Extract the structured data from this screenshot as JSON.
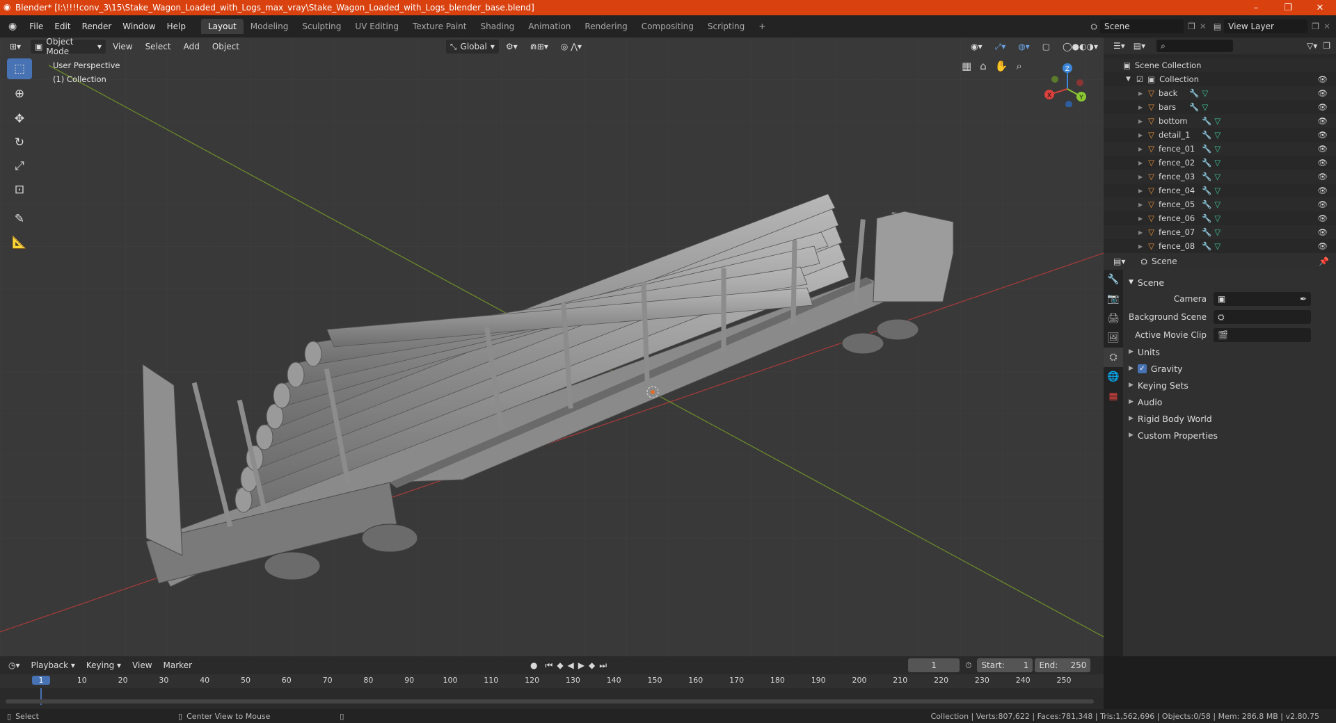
{
  "titlebar": {
    "title": "Blender* [I:\\!!!!conv_3\\15\\Stake_Wagon_Loaded_with_Logs_max_vray\\Stake_Wagon_Loaded_with_Logs_blender_base.blend]",
    "min": "–",
    "max": "❐",
    "close": "✕"
  },
  "menubar": {
    "menus": [
      "File",
      "Edit",
      "Render",
      "Window",
      "Help"
    ],
    "workspaces": [
      "Layout",
      "Modeling",
      "Sculpting",
      "UV Editing",
      "Texture Paint",
      "Shading",
      "Animation",
      "Rendering",
      "Compositing",
      "Scripting"
    ],
    "add_workspace": "+",
    "scene": "Scene",
    "view_layer": "View Layer"
  },
  "viewport": {
    "mode": "Object Mode",
    "menus": [
      "View",
      "Select",
      "Add",
      "Object"
    ],
    "orientation": "Global",
    "overlay_line1": "User Perspective",
    "overlay_line2": "(1) Collection",
    "gizmo": {
      "z": "Z",
      "y": "Y",
      "x": "X"
    },
    "colors": {
      "x_axis": "#d9413d",
      "y_axis": "#8ac832",
      "z_axis": "#3b86d8",
      "active": "#4772b3"
    }
  },
  "outliner": {
    "root": "Scene Collection",
    "collection": "Collection",
    "objects": [
      "back",
      "bars",
      "bottom",
      "detail_1",
      "fence_01",
      "fence_02",
      "fence_03",
      "fence_04",
      "fence_05",
      "fence_06",
      "fence_07",
      "fence_08"
    ]
  },
  "properties": {
    "header": "Scene",
    "panel": "Scene",
    "camera_label": "Camera",
    "background_scene_label": "Background Scene",
    "active_movie_clip_label": "Active Movie Clip",
    "subpanels": [
      "Units",
      "Gravity",
      "Keying Sets",
      "Audio",
      "Rigid Body World",
      "Custom Properties"
    ],
    "gravity_checked": true
  },
  "timeline": {
    "menus": [
      "Playback",
      "Keying",
      "View",
      "Marker"
    ],
    "current_frame": "1",
    "start_label": "Start:",
    "start": "1",
    "end_label": "End:",
    "end": "250",
    "ruler": [
      "1",
      "10",
      "20",
      "30",
      "40",
      "50",
      "60",
      "70",
      "80",
      "90",
      "100",
      "110",
      "120",
      "130",
      "140",
      "150",
      "160",
      "170",
      "180",
      "190",
      "200",
      "210",
      "220",
      "230",
      "240",
      "250"
    ]
  },
  "statusbar": {
    "select": "Select",
    "center_view": "Center View to Mouse",
    "stats": "Collection | Verts:807,622 | Faces:781,348 | Tris:1,562,696 | Objects:0/58 | Mem: 286.8 MB | v2.80.75"
  }
}
